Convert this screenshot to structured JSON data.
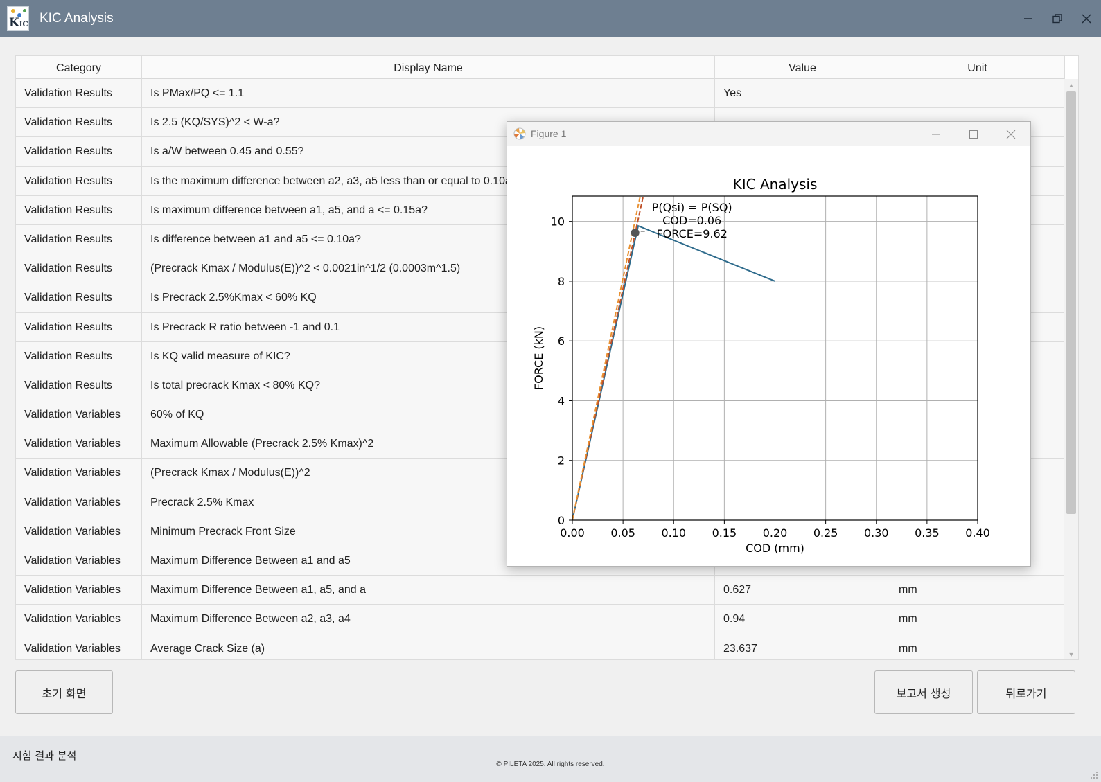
{
  "window": {
    "title": "KIC Analysis",
    "logo_text": "K",
    "logo_sub": "IC"
  },
  "table": {
    "headers": [
      "Category",
      "Display Name",
      "Value",
      "Unit"
    ],
    "rows": [
      {
        "category": "Validation Results",
        "name": "Is PMax/PQ <= 1.1",
        "value": "Yes",
        "unit": ""
      },
      {
        "category": "Validation Results",
        "name": "Is 2.5 (KQ/SYS)^2 < W-a?",
        "value": "",
        "unit": ""
      },
      {
        "category": "Validation Results",
        "name": "Is a/W between 0.45 and 0.55?",
        "value": "",
        "unit": ""
      },
      {
        "category": "Validation Results",
        "name": "Is the maximum difference between a2, a3, a5 less than or equal to 0.10a?",
        "value": "",
        "unit": ""
      },
      {
        "category": "Validation Results",
        "name": "Is maximum difference between a1, a5, and a <= 0.15a?",
        "value": "",
        "unit": ""
      },
      {
        "category": "Validation Results",
        "name": "Is difference between a1 and a5 <= 0.10a?",
        "value": "",
        "unit": ""
      },
      {
        "category": "Validation Results",
        "name": "(Precrack Kmax / Modulus(E))^2 < 0.0021in^1/2 (0.0003m^1.5)",
        "value": "",
        "unit": ""
      },
      {
        "category": "Validation Results",
        "name": "Is Precrack 2.5%Kmax < 60% KQ",
        "value": "",
        "unit": ""
      },
      {
        "category": "Validation Results",
        "name": "Is Precrack R ratio between -1 and 0.1",
        "value": "",
        "unit": ""
      },
      {
        "category": "Validation Results",
        "name": "Is KQ valid measure of KIC?",
        "value": "",
        "unit": ""
      },
      {
        "category": "Validation Results",
        "name": "Is total precrack Kmax < 80% KQ?",
        "value": "",
        "unit": ""
      },
      {
        "category": "Validation Variables",
        "name": "60% of KQ",
        "value": "",
        "unit": ""
      },
      {
        "category": "Validation Variables",
        "name": "Maximum Allowable (Precrack 2.5% Kmax)^2",
        "value": "",
        "unit": ""
      },
      {
        "category": "Validation Variables",
        "name": "(Precrack Kmax / Modulus(E))^2",
        "value": "",
        "unit": ""
      },
      {
        "category": "Validation Variables",
        "name": "Precrack 2.5% Kmax",
        "value": "",
        "unit": ""
      },
      {
        "category": "Validation Variables",
        "name": "Minimum Precrack Front Size",
        "value": "",
        "unit": ""
      },
      {
        "category": "Validation Variables",
        "name": "Maximum Difference Between a1 and a5",
        "value": "",
        "unit": ""
      },
      {
        "category": "Validation Variables",
        "name": "Maximum Difference Between a1, a5, and a",
        "value": "0.627",
        "unit": "mm"
      },
      {
        "category": "Validation Variables",
        "name": "Maximum Difference Between a2, a3, a4",
        "value": "0.94",
        "unit": "mm"
      },
      {
        "category": "Validation Variables",
        "name": "Average Crack Size (a)",
        "value": "23.637",
        "unit": "mm"
      }
    ]
  },
  "buttons": {
    "home": "초기 화면",
    "report": "보고서 생성",
    "back": "뒤로가기"
  },
  "statusbar": {
    "text": "시험 결과 분석",
    "copyright": "© PILETA 2025. All rights reserved."
  },
  "figure": {
    "title": "Figure 1"
  },
  "chart_data": {
    "type": "line",
    "title": "KIC Analysis",
    "xlabel": "COD (mm)",
    "ylabel": "FORCE (kN)",
    "xlim": [
      0,
      0.4
    ],
    "ylim": [
      0,
      10.85
    ],
    "xticks": [
      0.0,
      0.05,
      0.1,
      0.15,
      0.2,
      0.25,
      0.3,
      0.35,
      0.4
    ],
    "xtick_labels": [
      "0.00",
      "0.05",
      "0.10",
      "0.15",
      "0.20",
      "0.25",
      "0.30",
      "0.35",
      "0.40"
    ],
    "yticks": [
      0,
      2,
      4,
      6,
      8,
      10
    ],
    "ytick_labels": [
      "0",
      "2",
      "4",
      "6",
      "8",
      "10"
    ],
    "grid": true,
    "series": [
      {
        "style": "solid",
        "color": "#2e6b8c",
        "x": [
          0.0,
          0.065,
          0.2
        ],
        "y": [
          0.0,
          9.85,
          8.0
        ]
      },
      {
        "style": "dashed",
        "color": "#c0522a",
        "x": [
          0.0,
          0.07
        ],
        "y": [
          0.0,
          10.85
        ]
      },
      {
        "style": "dashed",
        "color": "#e89030",
        "x": [
          0.0,
          0.067
        ],
        "y": [
          0.0,
          10.85
        ]
      }
    ],
    "marker": {
      "x": 0.062,
      "y": 9.62,
      "color": "#555555"
    },
    "annotation": {
      "lines": [
        "P(Qsi) = P(SQ)",
        "COD=0.06",
        "FORCE=9.62"
      ],
      "x": 0.062,
      "y": 9.62
    }
  }
}
